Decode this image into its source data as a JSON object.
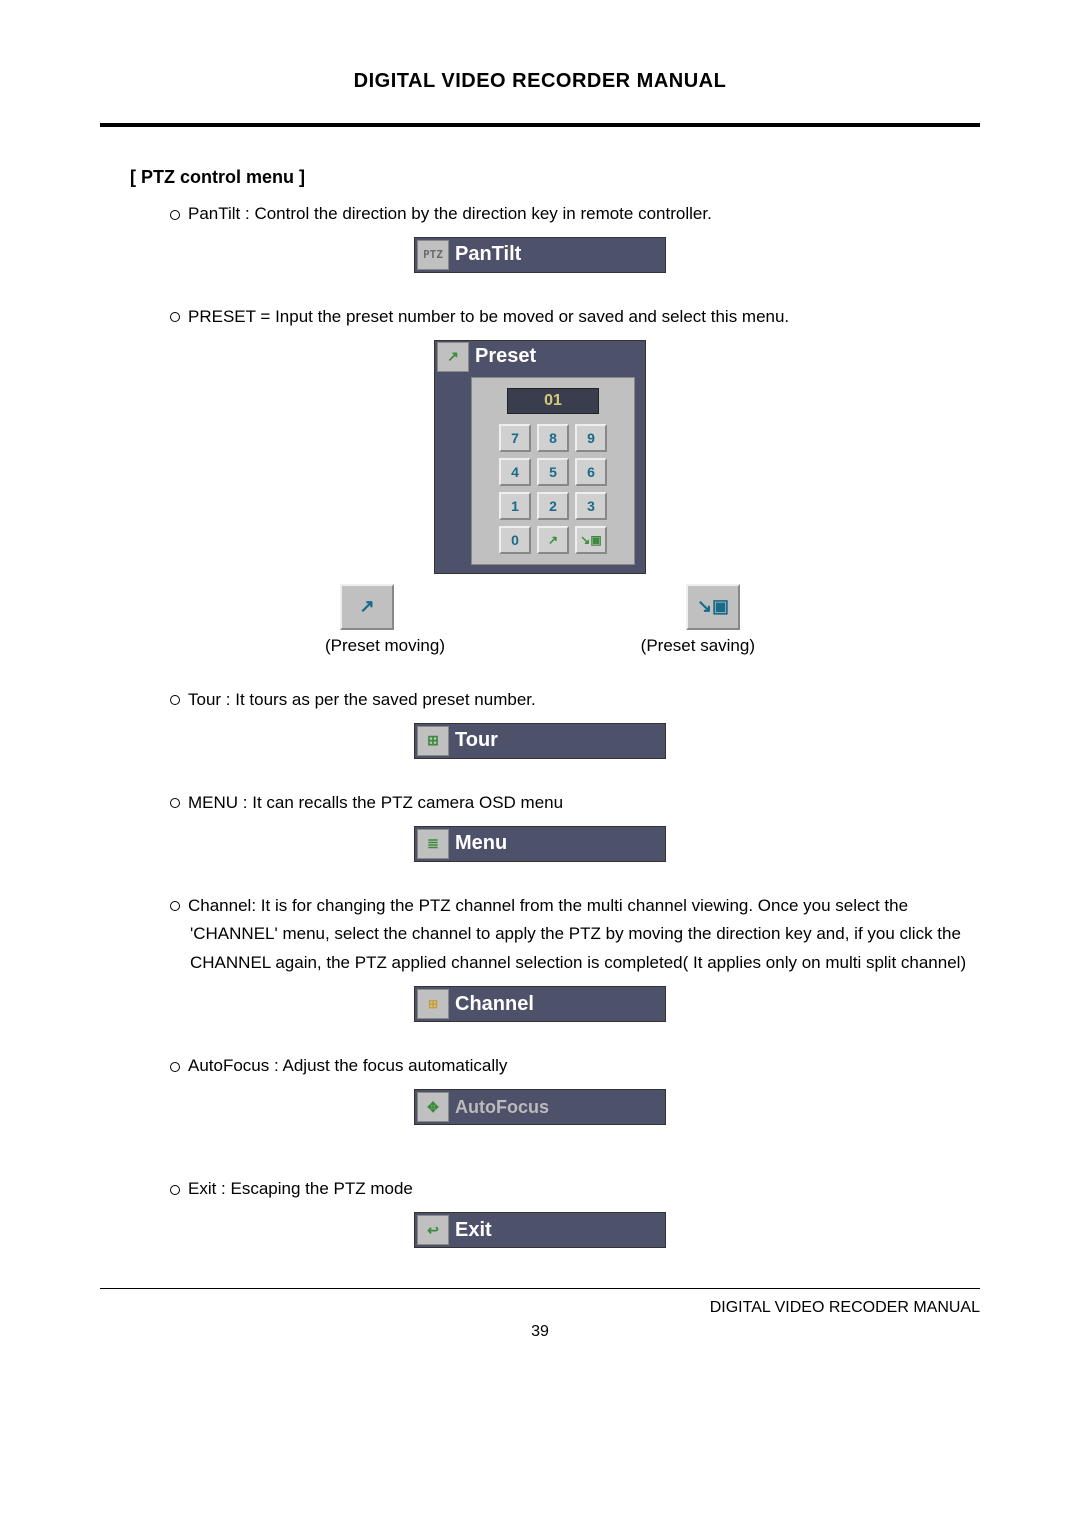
{
  "header": {
    "title": "DIGITAL VIDEO RECORDER MANUAL"
  },
  "section": {
    "title": "[ PTZ control menu ]"
  },
  "items": {
    "pantilt": {
      "text": "PanTilt : Control the direction by the direction key in remote controller.",
      "bar_label": "PanTilt",
      "icon_text": "PTZ"
    },
    "preset": {
      "text": "PRESET   = Input the preset number to be moved or saved and select this menu.",
      "bar_label": "Preset",
      "display_value": "01",
      "keys_row1": [
        "7",
        "8",
        "9"
      ],
      "keys_row2": [
        "4",
        "5",
        "6"
      ],
      "keys_row3": [
        "1",
        "2",
        "3"
      ],
      "key_zero": "0",
      "moving_label": "(Preset moving)",
      "saving_label": "(Preset saving)"
    },
    "tour": {
      "text": "Tour : It tours as per the saved preset number.",
      "bar_label": "Tour"
    },
    "menu": {
      "text": "MENU : It can recalls the PTZ camera OSD menu",
      "bar_label": "Menu"
    },
    "channel": {
      "text": "Channel: It is for changing the PTZ channel from the multi channel viewing. Once you select the 'CHANNEL' menu, select the channel to apply the PTZ by moving the direction key and, if you click the CHANNEL again, the PTZ applied channel selection is completed( It applies only on multi split channel)",
      "bar_label": "Channel"
    },
    "autofocus": {
      "text": "AutoFocus : Adjust the focus automatically",
      "bar_label": "AutoFocus"
    },
    "exit": {
      "text": "Exit : Escaping the PTZ mode",
      "bar_label": "Exit"
    }
  },
  "footer": {
    "text": "DIGITAL VIDEO RECODER MANUAL",
    "page_number": "39"
  }
}
